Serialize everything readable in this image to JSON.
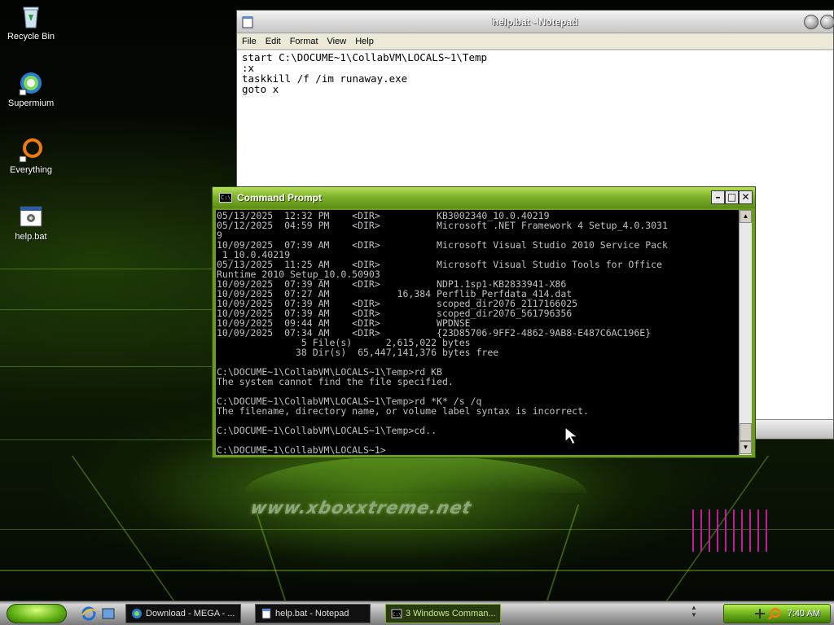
{
  "desktop": {
    "icons": [
      {
        "label": "Recycle Bin",
        "icon": "recycle-bin-icon"
      },
      {
        "label": "Supermium",
        "icon": "supermium-icon"
      },
      {
        "label": "Everything",
        "icon": "everything-icon"
      },
      {
        "label": "help.bat",
        "icon": "batch-file-icon"
      }
    ],
    "wallpaper_text": "www.xboxxtreme.net"
  },
  "notepad": {
    "title": "help.bat - Notepad",
    "menu": [
      "File",
      "Edit",
      "Format",
      "View",
      "Help"
    ],
    "content": "start C:\\DOCUME~1\\CollabVM\\LOCALS~1\\Temp\n:x\ntaskkill /f /im runaway.exe\ngoto x"
  },
  "cmd": {
    "title": "Command Prompt",
    "output": "05/13/2025  12:32 PM    <DIR>          KB3002340_10.0.40219\n05/12/2025  04:59 PM    <DIR>          Microsoft .NET Framework 4 Setup_4.0.3031\n9\n10/09/2025  07:39 AM    <DIR>          Microsoft Visual Studio 2010 Service Pack\n 1_10.0.40219\n05/13/2025  11:25 AM    <DIR>          Microsoft Visual Studio Tools for Office\nRuntime 2010 Setup_10.0.50903\n10/09/2025  07:39 AM    <DIR>          NDP1.1sp1-KB2833941-X86\n10/09/2025  07:27 AM            16,384 Perflib_Perfdata_414.dat\n10/09/2025  07:39 AM    <DIR>          scoped_dir2076_2117166025\n10/09/2025  07:39 AM    <DIR>          scoped_dir2076_561796356\n10/09/2025  09:44 AM    <DIR>          WPDNSE\n10/09/2025  07:34 AM    <DIR>          {23D85706-9FF2-4862-9AB8-E487C6AC196E}\n               5 File(s)      2,615,022 bytes\n              38 Dir(s)  65,447,141,376 bytes free\n\nC:\\DOCUME~1\\CollabVM\\LOCALS~1\\Temp>rd KB\nThe system cannot find the file specified.\n\nC:\\DOCUME~1\\CollabVM\\LOCALS~1\\Temp>rd *K* /s /q\nThe filename, directory name, or volume label syntax is incorrect.\n\nC:\\DOCUME~1\\CollabVM\\LOCALS~1\\Temp>cd..\n\nC:\\DOCUME~1\\CollabVM\\LOCALS~1>_"
  },
  "taskbar": {
    "buttons": [
      {
        "label": "Download - MEGA - ...",
        "icon": "browser-icon"
      },
      {
        "label": "help.bat - Notepad",
        "icon": "notepad-icon"
      },
      {
        "label": "3 Windows Comman...",
        "icon": "cmd-icon",
        "active": true
      }
    ],
    "clock": "7:40 AM"
  },
  "colors": {
    "accent": "#6a9b1e",
    "cmd_text": "#c0c0c0",
    "barcode": "#c21c9a"
  }
}
